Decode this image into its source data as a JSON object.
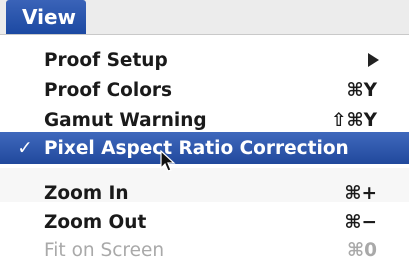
{
  "menubar": {
    "title": "View"
  },
  "menu": {
    "items": [
      {
        "label": "Proof Setup",
        "shortcut": "",
        "has_submenu": true,
        "checked": false,
        "highlighted": false,
        "enabled": true
      },
      {
        "label": "Proof Colors",
        "shortcut": "⌘Y",
        "has_submenu": false,
        "checked": false,
        "highlighted": false,
        "enabled": true
      },
      {
        "label": "Gamut Warning",
        "shortcut": "⇧⌘Y",
        "has_submenu": false,
        "checked": false,
        "highlighted": false,
        "enabled": true
      },
      {
        "label": "Pixel Aspect Ratio Correction",
        "shortcut": "",
        "has_submenu": false,
        "checked": true,
        "check_mark": "✓",
        "highlighted": true,
        "enabled": true
      },
      {
        "label": "Zoom In",
        "shortcut": "⌘+",
        "has_submenu": false,
        "checked": false,
        "highlighted": false,
        "enabled": true
      },
      {
        "label": "Zoom Out",
        "shortcut": "⌘−",
        "has_submenu": false,
        "checked": false,
        "highlighted": false,
        "enabled": true
      },
      {
        "label": "Fit on Screen",
        "shortcut": "⌘0",
        "has_submenu": false,
        "checked": false,
        "highlighted": false,
        "enabled": false
      }
    ]
  },
  "colors": {
    "highlight": "#2a55ad",
    "text": "#1a1a1a",
    "disabled_text": "#a9a9a9"
  }
}
